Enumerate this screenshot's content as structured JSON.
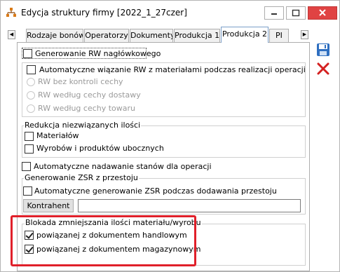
{
  "window": {
    "title": "Edycja struktury firmy [2022_1_27czer]"
  },
  "tabs": [
    {
      "label": "Rodzaje bonów"
    },
    {
      "label": "Operatorzy"
    },
    {
      "label": "Dokumenty"
    },
    {
      "label": "Produkcja 1"
    },
    {
      "label": "Produkcja 2",
      "active": true
    },
    {
      "label": "PI"
    }
  ],
  "panel": {
    "rw_header": {
      "label": "Generowanie RW nagłówkowego",
      "checked": false
    },
    "rw_auto": {
      "label": "Automatyczne wiązanie RW z materiałami podczas realizacji operacji",
      "checked": false
    },
    "rw_options": [
      {
        "label": "RW bez kontroli cechy"
      },
      {
        "label": "RW według cechy dostawy"
      },
      {
        "label": "RW według cechy towaru"
      }
    ],
    "reduction": {
      "title": "Redukcja niezwiązanych ilości",
      "materials": {
        "label": "Materiałów",
        "checked": false
      },
      "products": {
        "label": "Wyrobów i produktów ubocznych",
        "checked": false
      }
    },
    "auto_states": {
      "label": "Automatyczne nadawanie stanów dla operacji",
      "checked": false
    },
    "zsr": {
      "title": "Generowanie ZSR z przestoju",
      "auto": {
        "label": "Automatyczne generowanie ZSR podczas dodawania przestoju",
        "checked": false
      },
      "kontrahent_button": "Kontrahent",
      "kontrahent_value": ""
    },
    "block": {
      "title": "Blokada zmniejszania ilości materiału/wyrobu",
      "trade": {
        "label": "powiązanej z dokumentem handlowym",
        "checked": true
      },
      "warehouse": {
        "label": "powiązanej z dokumentem magazynowym",
        "checked": true
      }
    }
  },
  "colors": {
    "highlight": "#e0202a",
    "close": "#e04343",
    "save_icon": "#2f6fc0",
    "delete_icon": "#d42020"
  }
}
